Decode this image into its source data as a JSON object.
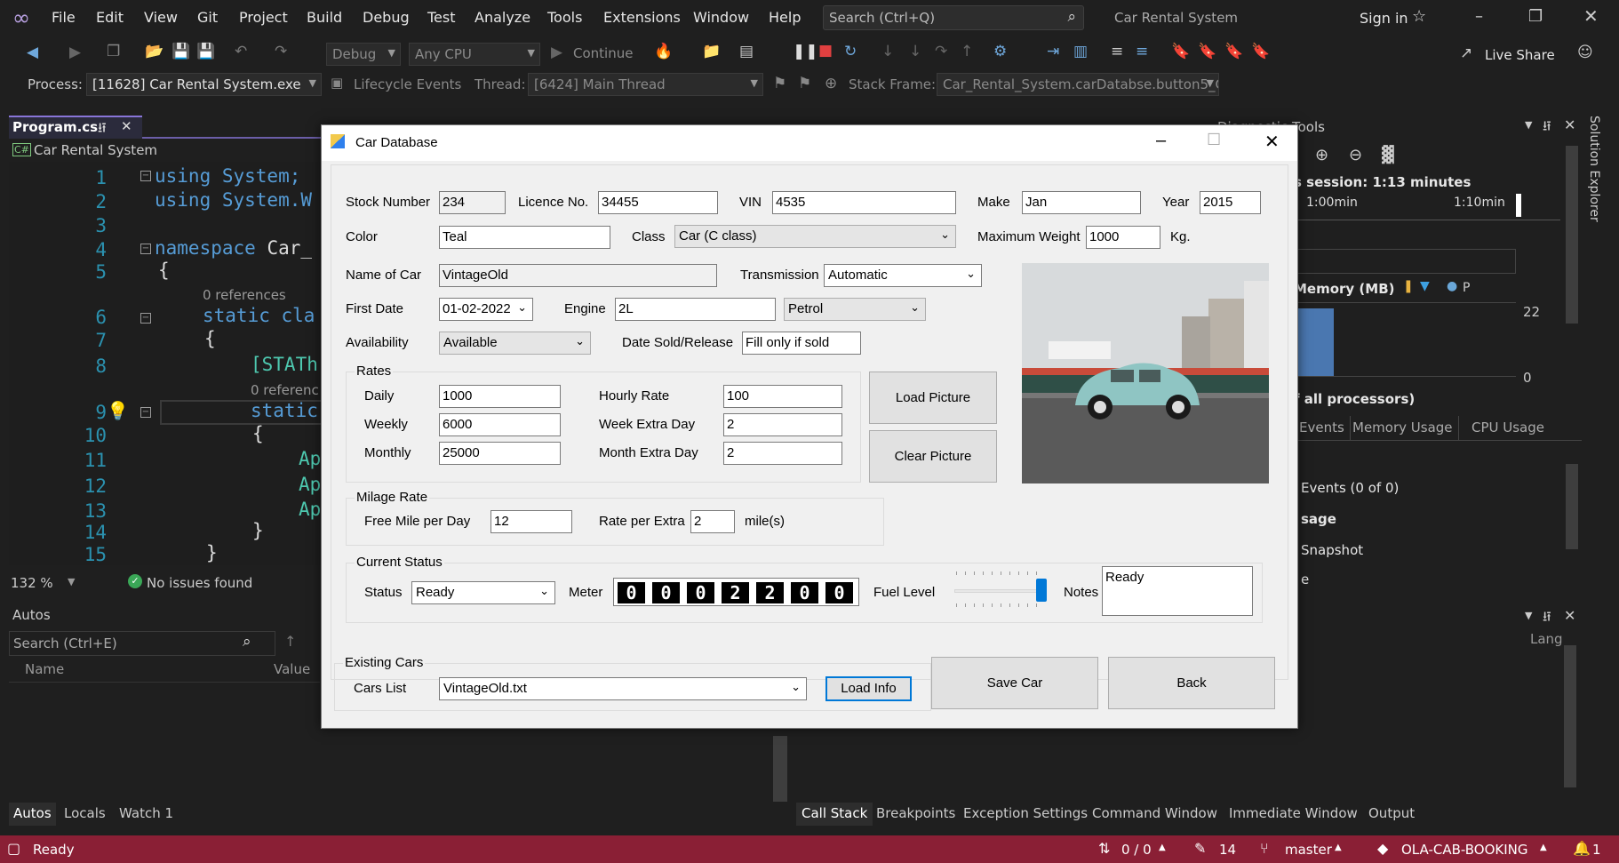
{
  "menu": [
    "File",
    "Edit",
    "View",
    "Git",
    "Project",
    "Build",
    "Debug",
    "Test",
    "Analyze",
    "Tools",
    "Extensions",
    "Window",
    "Help"
  ],
  "search_placeholder": "Search (Ctrl+Q)",
  "solution_name": "Car Rental System",
  "sign_in": "Sign in",
  "live_share": "Live Share",
  "toolbar": {
    "config": "Debug",
    "platform": "Any CPU",
    "continue": "Continue"
  },
  "debug_bar": {
    "process_label": "Process:",
    "process": "[11628] Car Rental System.exe",
    "lifecycle": "Lifecycle Events",
    "thread_label": "Thread:",
    "thread": "[6424] Main Thread",
    "stack_label": "Stack Frame:",
    "stack": "Car_Rental_System.carDatabse.button5_Cl"
  },
  "editor": {
    "tab": "Program.cs",
    "project": "Car Rental System",
    "lines": [
      "1",
      "2",
      "3",
      "4",
      "5",
      "6",
      "7",
      "8",
      "9",
      "10",
      "11",
      "12",
      "13",
      "14",
      "15"
    ],
    "refs": "0 references",
    "refs2": "0 referenc",
    "code": {
      "l1": "using System;",
      "l2": "using System.W",
      "l4a": "namespace",
      "l4b": " Car_",
      "l5": "{",
      "l6a": "static",
      "l6b": " cla",
      "l7": "{",
      "l8": "[STATh",
      "l9": "static",
      "l10": "{",
      "l11": "Ap",
      "l12": "Ap",
      "l13": "Ap",
      "l14": "}",
      "l15": "}"
    },
    "zoom": "132 %",
    "issues": "No issues found"
  },
  "autos": {
    "title": "Autos",
    "search_placeholder": "Search (Ctrl+E)",
    "col_name": "Name",
    "col_value": "Value",
    "tabs": [
      "Autos",
      "Locals",
      "Watch 1"
    ]
  },
  "diagnostics": {
    "title": "Diagnostic Tools",
    "session": "s session: 1:13 minutes",
    "t1": "1:00min",
    "t2": "1:10min",
    "memory": "Memory (MB)",
    "mem_legend": "P",
    "mem_max": "22",
    "mem_min": "0",
    "cpu": "f all processors)",
    "tabs": [
      "Events",
      "Memory Usage",
      "CPU Usage"
    ],
    "events": "Events (0 of 0)",
    "usage": "sage",
    "snapshot": "Snapshot",
    "e": "e"
  },
  "solution_explorer": "Solution Explorer",
  "bottom_right": {
    "lang": "Lang",
    "tabs": [
      "Call Stack",
      "Breakpoints",
      "Exception Settings",
      "Command Window",
      "Immediate Window",
      "Output"
    ]
  },
  "status": {
    "ready": "Ready",
    "updown": "0 / 0",
    "pencil": "14",
    "branch": "master",
    "repo": "OLA-CAB-BOOKING",
    "bell": "1"
  },
  "dialog": {
    "title": "Car Database",
    "labels": {
      "stock": "Stock Number",
      "licence": "Licence No.",
      "vin": "VIN",
      "make": "Make",
      "year": "Year",
      "color": "Color",
      "class": "Class",
      "max_weight": "Maximum Weight",
      "kg": "Kg.",
      "name": "Name of Car",
      "transmission": "Transmission",
      "first_date": "First Date",
      "engine": "Engine",
      "availability": "Availability",
      "date_sold": "Date Sold/Release",
      "rates": "Rates",
      "daily": "Daily",
      "hourly": "Hourly Rate",
      "weekly": "Weekly",
      "week_extra": "Week Extra Day",
      "monthly": "Monthly",
      "month_extra": "Month Extra Day",
      "milage": "Milage Rate",
      "free_mile": "Free Mile per Day",
      "rate_extra": "Rate per Extra",
      "miles": "mile(s)",
      "current_status": "Current Status",
      "status": "Status",
      "meter": "Meter",
      "fuel": "Fuel Level",
      "notes": "Notes",
      "existing": "Existing Cars",
      "cars_list": "Cars List"
    },
    "values": {
      "stock": "234",
      "licence": "34455",
      "vin": "4535",
      "make": "Jan",
      "year": "2015",
      "color": "Teal",
      "class": "Car (C class)",
      "max_weight": "1000",
      "name": "VintageOld",
      "transmission": "Automatic",
      "first_date": "01-02-2022",
      "engine": "2L",
      "fuel_type": "Petrol",
      "availability": "Available",
      "date_sold": "Fill only if sold",
      "daily": "1000",
      "hourly": "100",
      "weekly": "6000",
      "week_extra": "2",
      "monthly": "25000",
      "month_extra": "2",
      "free_mile": "12",
      "rate_extra": "2",
      "status": "Ready",
      "meter": [
        "0",
        "0",
        "0",
        "2",
        "2",
        "0",
        "0"
      ],
      "fuel_level": 1.0,
      "notes": "Ready",
      "cars_list": "VintageOld.txt"
    },
    "buttons": {
      "load_picture": "Load Picture",
      "clear_picture": "Clear Picture",
      "load_info": "Load Info",
      "save": "Save Car",
      "back": "Back"
    }
  }
}
